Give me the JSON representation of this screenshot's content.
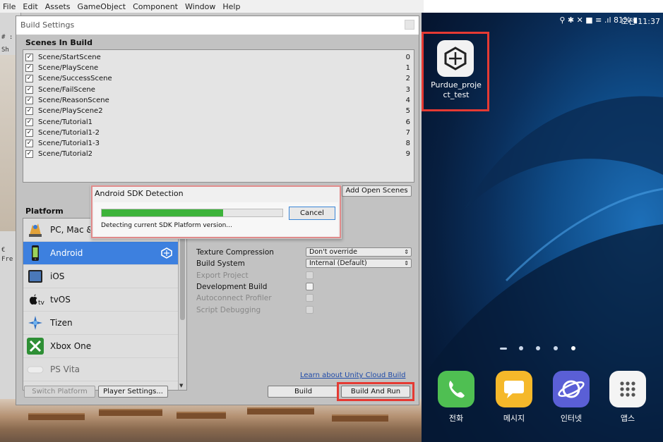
{
  "menubar": {
    "items": [
      "File",
      "Edit",
      "Assets",
      "GameObject",
      "Component",
      "Window",
      "Help"
    ]
  },
  "editor": {
    "left_panel_texts": [
      "# :",
      "Sh",
      "€",
      "Fre"
    ]
  },
  "build_settings": {
    "title": "Build Settings",
    "scenes_header": "Scenes In Build",
    "scenes": [
      {
        "name": "Scene/StartScene",
        "index": "0",
        "checked": true
      },
      {
        "name": "Scene/PlayScene",
        "index": "1",
        "checked": true
      },
      {
        "name": "Scene/SuccessScene",
        "index": "2",
        "checked": true
      },
      {
        "name": "Scene/FailScene",
        "index": "3",
        "checked": true
      },
      {
        "name": "Scene/ReasonScene",
        "index": "4",
        "checked": true
      },
      {
        "name": "Scene/PlayScene2",
        "index": "5",
        "checked": true
      },
      {
        "name": "Scene/Tutorial1",
        "index": "6",
        "checked": true
      },
      {
        "name": "Scene/Tutorial1-2",
        "index": "7",
        "checked": true
      },
      {
        "name": "Scene/Tutorial1-3",
        "index": "8",
        "checked": true
      },
      {
        "name": "Scene/Tutorial2",
        "index": "9",
        "checked": true
      }
    ],
    "add_open_scenes": "Add Open Scenes",
    "platform_header": "Platform",
    "platforms": [
      {
        "label": "PC, Mac &",
        "icon": "pc-mac-linux-icon",
        "selected": false
      },
      {
        "label": "Android",
        "icon": "android-icon",
        "selected": true
      },
      {
        "label": "iOS",
        "icon": "ios-icon",
        "selected": false
      },
      {
        "label": "tvOS",
        "icon": "tvos-icon",
        "prefix": "tv",
        "selected": false
      },
      {
        "label": "Tizen",
        "icon": "tizen-icon",
        "selected": false
      },
      {
        "label": "Xbox One",
        "icon": "xbox-one-icon",
        "selected": false
      },
      {
        "label": "PS Vita",
        "icon": "ps-vita-icon",
        "selected": false
      }
    ],
    "settings": {
      "texture_compression_label": "Texture Compression",
      "texture_compression_value": "Don't override",
      "build_system_label": "Build System",
      "build_system_value": "Internal (Default)",
      "export_project_label": "Export Project",
      "development_build_label": "Development Build",
      "autoconnect_profiler_label": "Autoconnect Profiler",
      "script_debugging_label": "Script Debugging"
    },
    "cloud_link": "Learn about Unity Cloud Build",
    "switch_platform": "Switch Platform",
    "player_settings": "Player Settings...",
    "build": "Build",
    "build_and_run": "Build And Run"
  },
  "sdk_dialog": {
    "title": "Android SDK Detection",
    "progress_fraction": 0.67,
    "status": "Detecting current SDK Platform version...",
    "cancel": "Cancel",
    "progress_color": "#3db33a"
  },
  "phone": {
    "status_icons": "⚲ ✱ ✕ ■  ≡ .ıl 81% ▮",
    "time": "오전 11:37",
    "app_label": "Purdue_proje ct_test",
    "dock": [
      {
        "label": "전화",
        "icon": "phone-icon",
        "color": "#4fbf52"
      },
      {
        "label": "메시지",
        "icon": "messages-icon",
        "color": "#f5b82a"
      },
      {
        "label": "인터넷",
        "icon": "internet-icon",
        "color": "#5a5fd6"
      },
      {
        "label": "앱스",
        "icon": "apps-icon",
        "color": "#f4f4f4"
      }
    ]
  },
  "colors": {
    "highlight_red": "#e53a33",
    "unity_selected_blue": "#3d80df"
  }
}
